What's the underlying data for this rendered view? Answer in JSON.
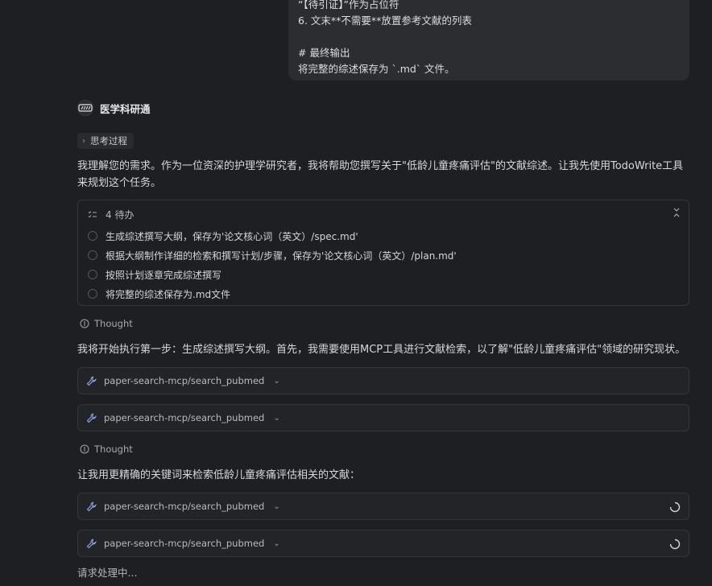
{
  "user_message": {
    "lines": [
      "“【待引证】”作为占位符",
      "6. 文末**不需要**放置参考文献的列表",
      "",
      "# 最终输出",
      "将完整的综述保存为 `.md` 文件。"
    ]
  },
  "assistant": {
    "name": "医学科研通",
    "thinking_label": "思考过程",
    "intro": "我理解您的需求。作为一位资深的护理学研究者，我将帮助您撰写关于\"低龄儿童疼痛评估\"的文献综述。让我先使用TodoWrite工具来规划这个任务。",
    "todo": {
      "header": "4 待办",
      "items": [
        "生成综述撰写大纲，保存为'论文核心词（英文）/spec.md'",
        "根据大纲制作详细的检索和撰写计划/步骤，保存为'论文核心词（英文）/plan.md'",
        "按照计划逐章完成综述撰写",
        "将完整的综述保存为.md文件"
      ]
    },
    "thought_label": "Thought",
    "step_text": "我将开始执行第一步：生成综述撰写大纲。首先，我需要使用MCP工具进行文献检索，以了解\"低龄儿童疼痛评估\"领域的研究现状。",
    "refine_text": "让我用更精确的关键词来检索低龄儿童疼痛评估相关的文献：",
    "tool_name": "paper-search-mcp/search_pubmed",
    "status": "请求处理中..."
  }
}
